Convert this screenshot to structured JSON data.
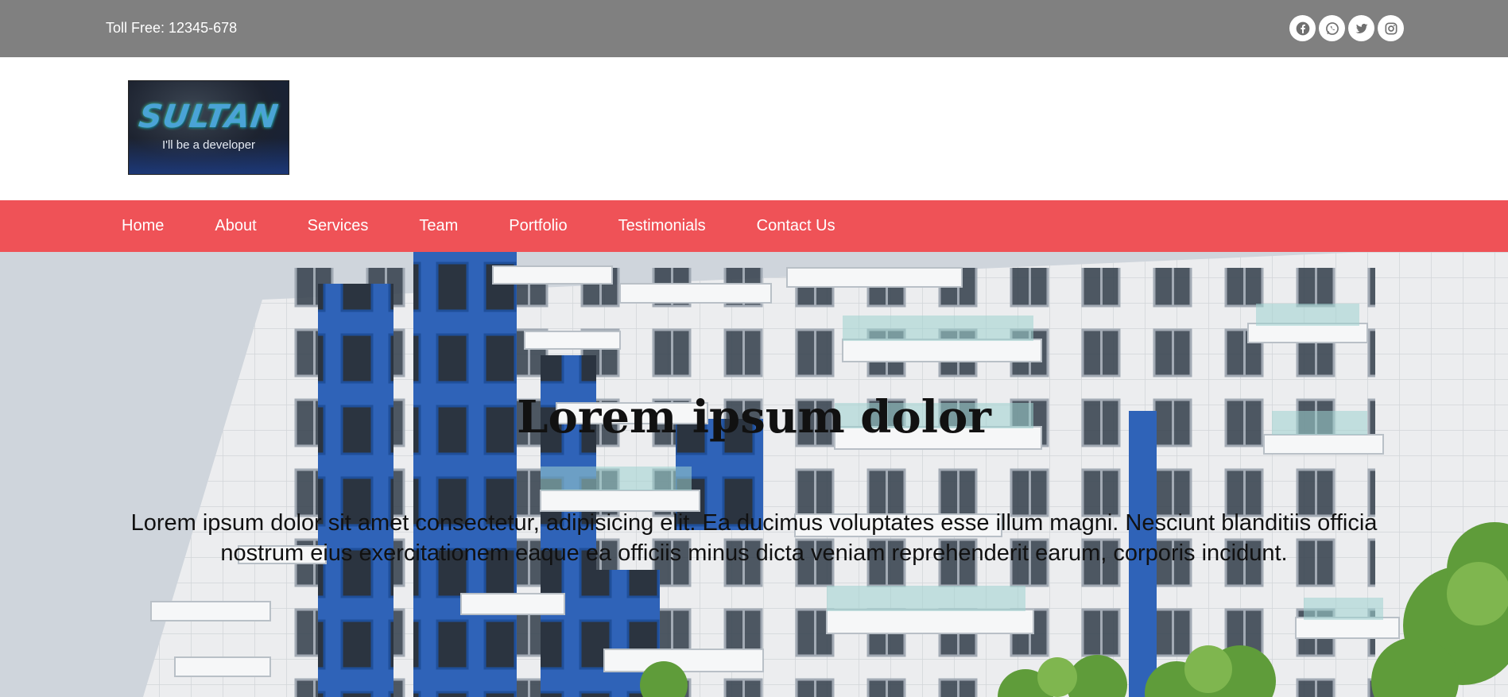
{
  "topbar": {
    "toll_free": "Toll Free: 12345-678",
    "socials": [
      "facebook-icon",
      "whatsapp-icon",
      "twitter-icon",
      "instagram-icon"
    ]
  },
  "header": {
    "logo_title": "SULTAN",
    "logo_subtitle": "I'll be a developer"
  },
  "nav": {
    "items": [
      "Home",
      "About",
      "Services",
      "Team",
      "Portfolio",
      "Testimonials",
      "Contact Us"
    ]
  },
  "hero": {
    "title": "Lorem ipsum dolor",
    "text": "Lorem ipsum dolor sit amet consectetur, adipisicing elit. Ea ducimus voluptates esse illum magni. Nesciunt blanditiis officia nostrum eius exercitationem eaque ea officiis minus dicta veniam reprehenderit earum, corporis incidunt."
  },
  "colors": {
    "topbar": "#808080",
    "nav": "#ef5257",
    "facade_blue": "#2f63b8"
  }
}
